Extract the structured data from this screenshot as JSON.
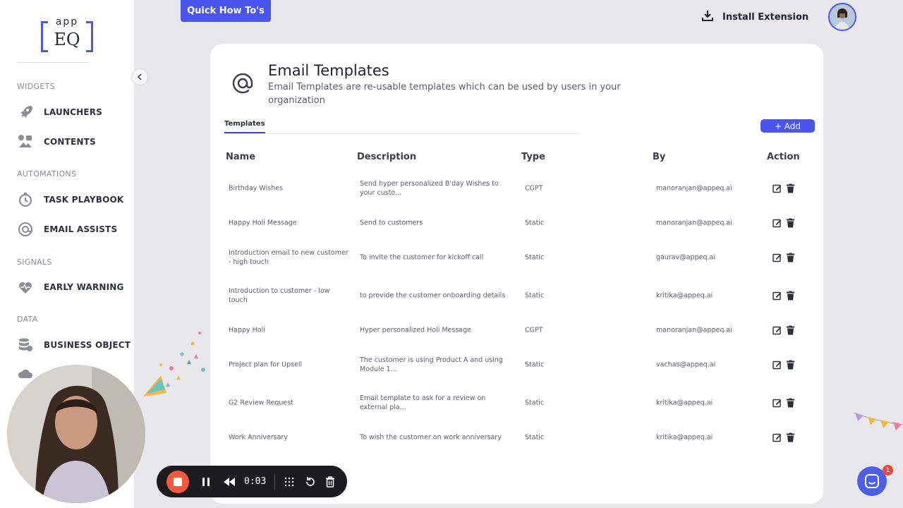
{
  "logo": {
    "top": "app",
    "main": "EQ"
  },
  "sidebar": {
    "sections": [
      {
        "label": "WIDGETS"
      },
      {
        "label": "AUTOMATIONS"
      },
      {
        "label": "SIGNALS"
      },
      {
        "label": "DATA"
      }
    ],
    "items": [
      {
        "label": "LAUNCHERS",
        "icon": "rocket-icon"
      },
      {
        "label": "CONTENTS",
        "icon": "contents-icon"
      },
      {
        "label": "TASK PLAYBOOK",
        "icon": "timer-icon"
      },
      {
        "label": "EMAIL ASSISTS",
        "icon": "email-assist-icon"
      },
      {
        "label": "EARLY WARNING",
        "icon": "heart-signal-icon"
      },
      {
        "label": "BUSINESS OBJECT",
        "icon": "database-icon"
      }
    ]
  },
  "header": {
    "quick_howtos": "Quick How To's",
    "install_extension": "Install Extension"
  },
  "page": {
    "title": "Email Templates",
    "subtitle": "Email Templates are re-usable templates which can be used by users in your organization",
    "tab": "Templates",
    "add_button": "+ Add"
  },
  "table": {
    "headers": {
      "name": "Name",
      "description": "Description",
      "type": "Type",
      "by": "By",
      "action": "Action"
    },
    "rows": [
      {
        "name": "Birthday Wishes",
        "description": "Send hyper personalized B'day Wishes to your custo...",
        "type": "CGPT",
        "by": "manoranjan@appeq.ai"
      },
      {
        "name": "Happy Holi Message",
        "description": "Send to customers",
        "type": "Static",
        "by": "manoranjan@appeq.ai"
      },
      {
        "name": "Introduction email to new customer - high touch",
        "description": "To invite the customer for kickoff call",
        "type": "Static",
        "by": "gaurav@appeq.ai"
      },
      {
        "name": "Introduction to customer - low touch",
        "description": "to provide the customer onboarding details",
        "type": "Static",
        "by": "kritika@appeq.ai"
      },
      {
        "name": "Happy Holi",
        "description": "Hyper personalized Holi Message",
        "type": "CGPT",
        "by": "manoranjan@appeq.ai"
      },
      {
        "name": "Project plan for Upsell",
        "description": "The customer is using Product A and using Module 1...",
        "type": "Static",
        "by": "vachas@appeq.ai"
      },
      {
        "name": "G2 Review Request",
        "description": "Email template to ask for a review on external pla...",
        "type": "Static",
        "by": "kritika@appeq.ai"
      },
      {
        "name": "Work Anniversary",
        "description": "To wish the customer on work anniversary",
        "type": "Static",
        "by": "kritika@appeq.ai"
      }
    ]
  },
  "recorder": {
    "timer": "0:03"
  },
  "chat": {
    "badge": "1"
  },
  "colors": {
    "accent": "#4a55f0",
    "record": "#f2583e",
    "badge": "#f0463c"
  }
}
